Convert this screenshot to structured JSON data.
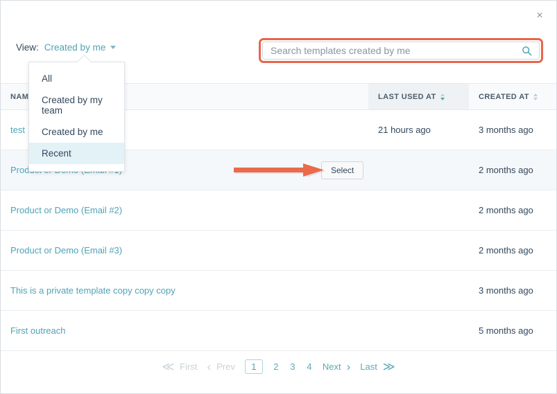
{
  "window": {
    "close_label": "×"
  },
  "view_selector": {
    "label": "View:",
    "selected": "Created by me",
    "caret_icon": "chevron-down-icon",
    "options": [
      {
        "label": "All",
        "selected": false
      },
      {
        "label": "Created by my team",
        "selected": false
      },
      {
        "label": "Created by me",
        "selected": false
      },
      {
        "label": "Recent",
        "selected": true
      }
    ]
  },
  "search": {
    "placeholder": "Search templates created by me",
    "value": "",
    "icon": "search-icon",
    "highlight_color": "#e8654a"
  },
  "table": {
    "columns": [
      {
        "key": "name",
        "label": "NAME",
        "sortable": true,
        "sort_active": false
      },
      {
        "key": "action",
        "label": "",
        "sortable": false,
        "sort_active": false
      },
      {
        "key": "last_used_at",
        "label": "LAST USED AT",
        "sortable": true,
        "sort_active": true
      },
      {
        "key": "created_at",
        "label": "CREATED AT",
        "sortable": true,
        "sort_active": false
      }
    ],
    "action_label": "Select",
    "rows": [
      {
        "name": "test",
        "last_used_at": "21 hours ago",
        "created_at": "3 months ago",
        "highlight": false,
        "show_action": false
      },
      {
        "name": "Product or Demo (Email #1)",
        "last_used_at": "",
        "created_at": "2 months ago",
        "highlight": true,
        "show_action": true
      },
      {
        "name": "Product or Demo (Email #2)",
        "last_used_at": "",
        "created_at": "2 months ago",
        "highlight": false,
        "show_action": false
      },
      {
        "name": "Product or Demo (Email #3)",
        "last_used_at": "",
        "created_at": "2 months ago",
        "highlight": false,
        "show_action": false
      },
      {
        "name": "This is a private template copy copy copy",
        "last_used_at": "",
        "created_at": "3 months ago",
        "highlight": false,
        "show_action": false
      },
      {
        "name": "First outreach",
        "last_used_at": "",
        "created_at": "5 months ago",
        "highlight": false,
        "show_action": false
      }
    ]
  },
  "pagination": {
    "first_label": "First",
    "prev_label": "Prev",
    "next_label": "Next",
    "last_label": "Last",
    "pages": [
      "1",
      "2",
      "3",
      "4"
    ],
    "current_page": "1",
    "first_icon": "double-chevron-left-icon",
    "prev_icon": "chevron-left-icon",
    "next_icon": "chevron-right-icon",
    "last_icon": "double-chevron-right-icon"
  },
  "annotations": {
    "arrow_color": "#ea6a4b",
    "arrow_points_to": "Select"
  }
}
